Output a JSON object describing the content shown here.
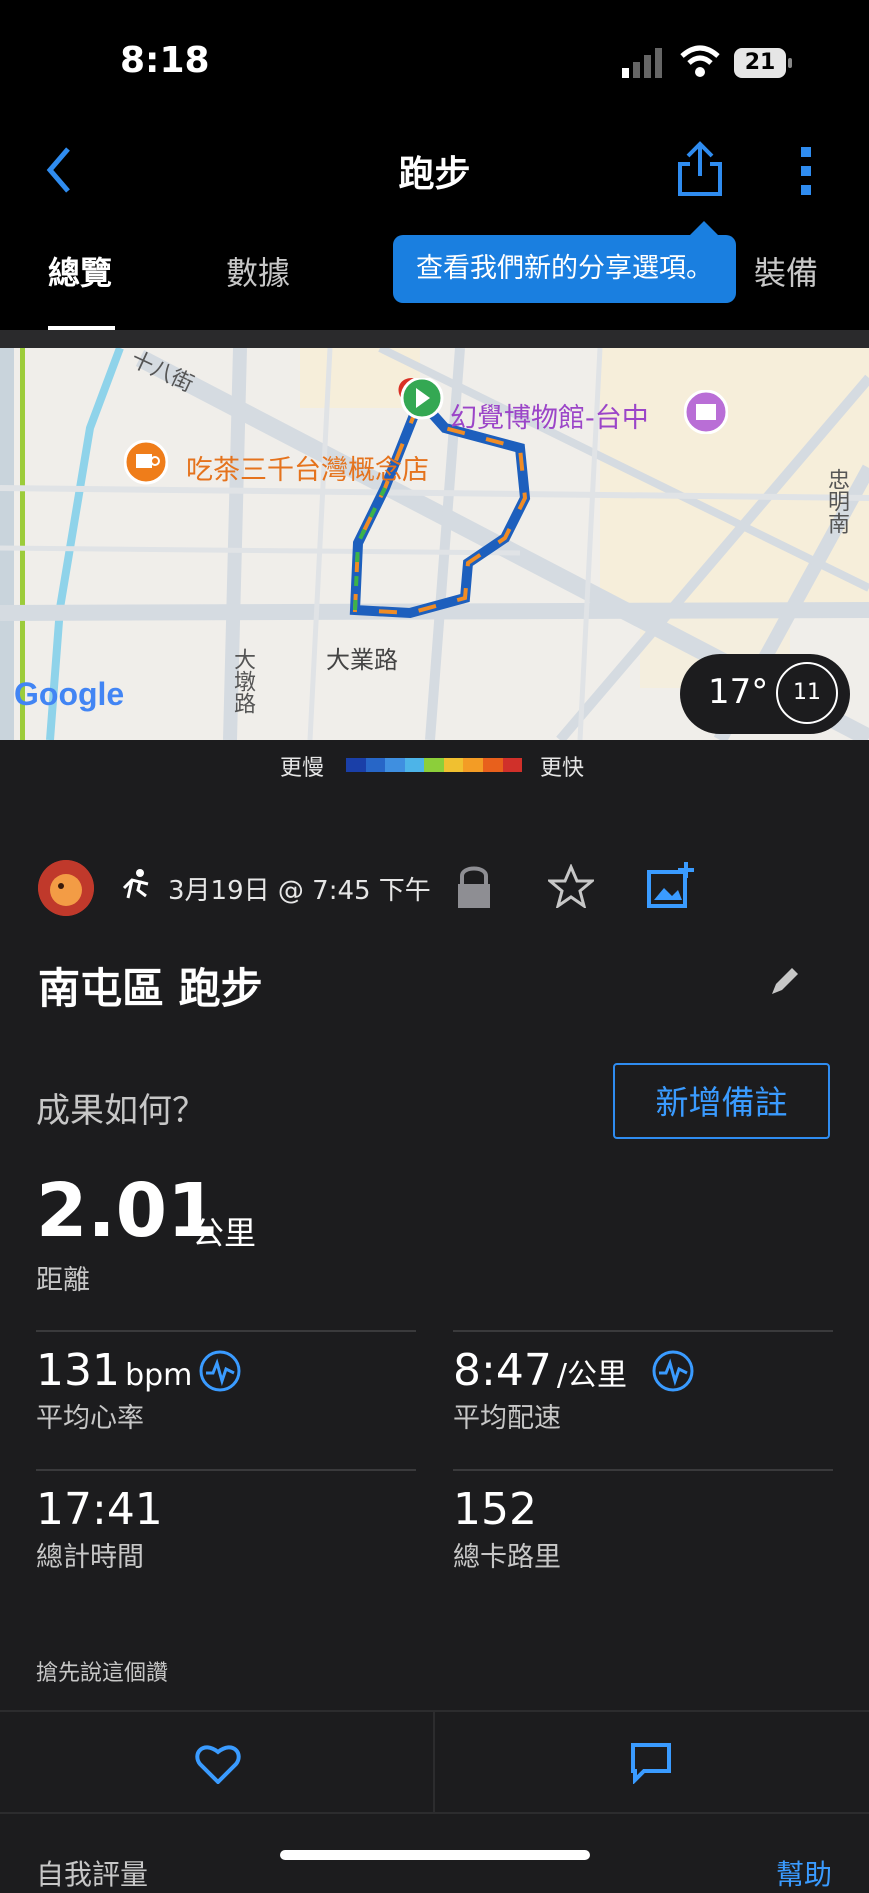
{
  "status": {
    "time": "8:18",
    "battery": "21"
  },
  "header": {
    "title": "跑步",
    "back_icon": "chevron-left-icon",
    "share_icon": "share-icon",
    "more_icon": "more-vertical-icon"
  },
  "tabs": [
    {
      "label": "總覽",
      "active": true
    },
    {
      "label": "數據",
      "active": false
    },
    {
      "label": "裝備",
      "active": false
    }
  ],
  "tooltip": "查看我們新的分享選項。",
  "map": {
    "labels": {
      "street_top": "十八街",
      "museum": "幻覺博物館-台中",
      "cafe": "吃茶三千台灣概念店",
      "street_bottom": "大業路",
      "street_left": "大墩路",
      "street_right": "忠明南",
      "google": "Google"
    },
    "weather_temp": "17°",
    "weather_badge": "11"
  },
  "legend": {
    "slower": "更慢",
    "faster": "更快",
    "colors": [
      "#1a3fa8",
      "#2766c7",
      "#3f8fe0",
      "#4db4e8",
      "#8ccf3a",
      "#f0c030",
      "#f39c25",
      "#e8601c",
      "#d0302a"
    ]
  },
  "activity": {
    "date": "3月19日 @ 7:45 下午",
    "title": "南屯區 跑步",
    "question": "成果如何？",
    "add_note": "新增備註"
  },
  "distance": {
    "value": "2.01",
    "unit": "公里",
    "label": "距離"
  },
  "stats": [
    {
      "value": "131",
      "unit": "bpm",
      "label": "平均心率",
      "icon": "heart-rate-icon"
    },
    {
      "value": "8:47",
      "unit": "/公里",
      "label": "平均配速",
      "icon": "pace-icon"
    },
    {
      "value": "17:41",
      "unit": "",
      "label": "總計時間"
    },
    {
      "value": "152",
      "unit": "",
      "label": "總卡路里"
    }
  ],
  "social": {
    "first_like": "搶先說這個讚"
  },
  "footer": {
    "self_eval": "自我評量",
    "help": "幫助"
  },
  "colors": {
    "accent": "#3a9bff",
    "tooltip": "#1a7fe0",
    "background": "#1c1c1e"
  }
}
